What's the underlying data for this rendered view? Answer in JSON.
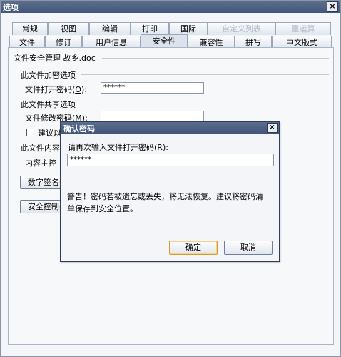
{
  "window": {
    "title": "选项"
  },
  "tabs_row1": [
    "常规",
    "视图",
    "编辑",
    "打印",
    "国际",
    "自定义列表",
    "重运算"
  ],
  "tabs_row2": [
    "文件",
    "修订",
    "用户信息",
    "安全性",
    "兼容性",
    "拼写",
    "中文版式"
  ],
  "security": {
    "heading": "文件安全管理 故乡.doc",
    "encrypt_group": "此文件加密选项",
    "open_pwd_label": "文件打开密码(",
    "open_pwd_key": "O",
    "open_pwd_label_end": "):",
    "open_pwd_value": "******",
    "share_group": "此文件共享选项",
    "modify_pwd_label": "文件修改密码(M):",
    "modify_pwd_value": "",
    "readonly_check_label": "建议以",
    "content_group": "此文件内容",
    "content_label": "内容主控",
    "digital_sign_button": "数字签名(",
    "security_control_button": "安全控制("
  },
  "dialog": {
    "title": "确认密码",
    "prompt": "请再次输入文件打开密码(",
    "prompt_key": "R",
    "prompt_end": "):",
    "value": "******",
    "warning_line1": "警告！密码若被遗忘或丢失，将无法恢复。建议将密码清",
    "warning_line2": "单保存到安全位置。",
    "ok": "确定",
    "cancel": "取消"
  }
}
